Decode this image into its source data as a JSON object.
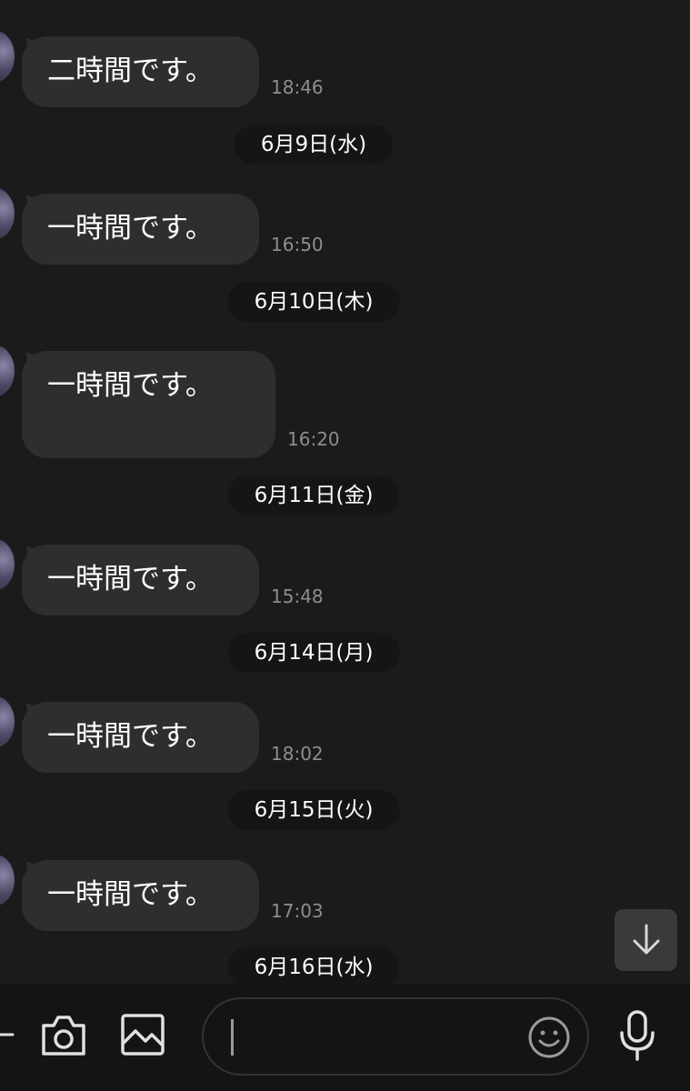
{
  "messages": [
    {
      "text": "二時間です。",
      "time": "18:46",
      "date_after": "6月9日(水)"
    },
    {
      "text": "一時間です。",
      "time": "16:50",
      "date_after": "6月10日(木)"
    },
    {
      "text": "一時間です。",
      "time": "16:20",
      "date_after": "6月11日(金)"
    },
    {
      "text": "一時間です。",
      "time": "15:48",
      "date_after": "6月14日(月)"
    },
    {
      "text": "一時間です。",
      "time": "18:02",
      "date_after": "6月15日(火)"
    },
    {
      "text": "一時間です。",
      "time": "17:03",
      "date_after": "6月16日(水)"
    }
  ],
  "footer": {
    "input_value": "",
    "icons": [
      "plus-icon",
      "camera-icon",
      "image-icon",
      "emoji-icon",
      "microphone-icon"
    ]
  },
  "scroll_button_icon": "arrow-down-icon",
  "colors": {
    "background": "#1b1b1c",
    "bubble": "#2e2e2f",
    "date_pill": "#151515",
    "time_text": "#8e8e8e"
  }
}
